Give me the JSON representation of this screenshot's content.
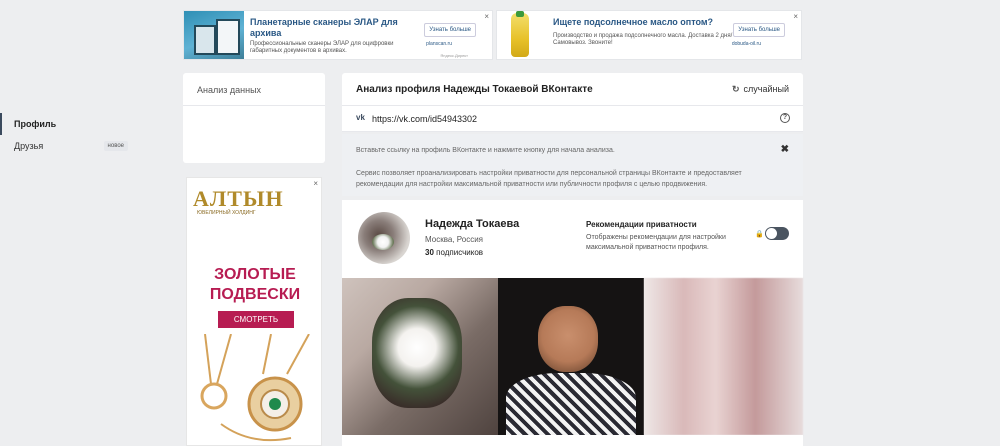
{
  "ads": {
    "top": [
      {
        "title": "Планетарные сканеры ЭЛАР для архива",
        "text": "Профессиональные сканеры ЭЛАР для оцифровки габаритных документов в архивах.",
        "button": "Узнать больше",
        "domain": "planscan.ru",
        "source": "Яндекс.Директ",
        "close": "×"
      },
      {
        "title": "Ищете подсолнечное масло оптом?",
        "text": "Производство и продажа подсолнечного масла. Доставка 2 дня/Самовывоз. Звоните!",
        "button": "Узнать больше",
        "domain": "dobuda-oil.ru",
        "close": "×"
      }
    ],
    "side": {
      "logo": "АЛТЫН",
      "logo_sub": "ЮВЕЛИРНЫЙ ХОЛДИНГ",
      "headline_1": "ЗОЛОТЫЕ",
      "headline_2": "ПОДВЕСКИ",
      "button": "СМОТРЕТЬ",
      "close": "×"
    }
  },
  "left_menu": {
    "title": "Анализ данных",
    "items": [
      {
        "label": "Профиль",
        "active": true
      },
      {
        "label": "Друзья",
        "badge": "новое"
      }
    ]
  },
  "main": {
    "title": "Анализ профиля Надежды Токаевой ВКонтакте",
    "random_label": "случайный",
    "random_icon": "↻",
    "vk_icon": "vk",
    "url_value": "https://vk.com/id54943302",
    "help_icon": "?",
    "info_line_1": "Вставьте ссылку на профиль ВКонтакте и нажмите кнопку для начала анализа.",
    "info_line_2": "Сервис позволяет проанализировать настройки приватности для персональной страницы ВКонтакте и предоставляет рекомендации для настройки максимальной приватности или публичности профиля с целью продвижения.",
    "info_close": "✖"
  },
  "profile": {
    "name": "Надежда Токаева",
    "city": "Москва, Россия",
    "subscribers_count": "30",
    "subscribers_label": "подписчиков",
    "rec_title": "Рекомендации приватности",
    "rec_text": "Отображены рекомендации для настройки максимальной приватности профиля.",
    "lock_icon": "🔒",
    "toggle_on": false
  }
}
